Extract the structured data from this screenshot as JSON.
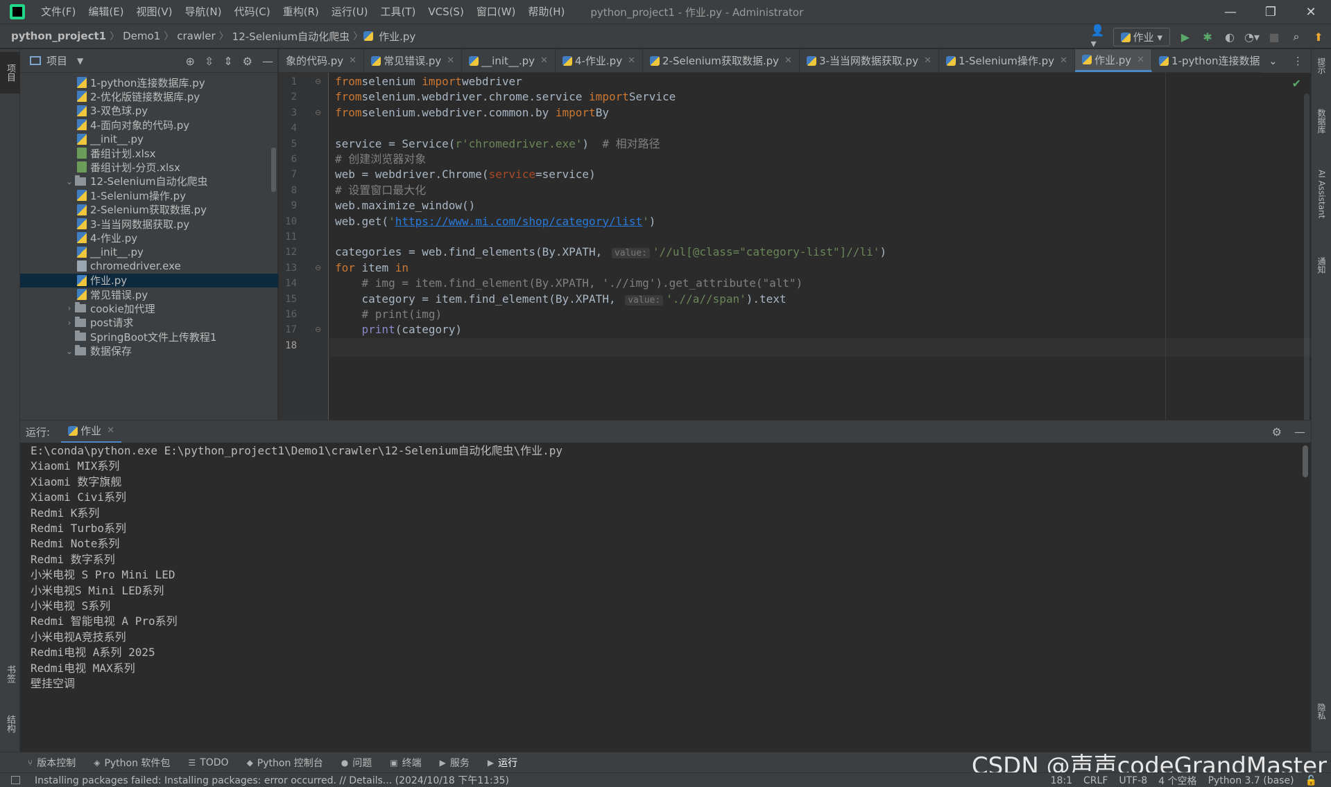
{
  "menu": [
    "文件(F)",
    "编辑(E)",
    "视图(V)",
    "导航(N)",
    "代码(C)",
    "重构(R)",
    "运行(U)",
    "工具(T)",
    "VCS(S)",
    "窗口(W)",
    "帮助(H)"
  ],
  "window_title": "python_project1 - 作业.py - Administrator",
  "breadcrumbs": [
    "python_project1",
    "Demo1",
    "crawler",
    "12-Selenium自动化爬虫",
    "作业.py"
  ],
  "run_config": "作业",
  "left_stripe": {
    "project": "项目",
    "bookmarks": "书签",
    "structure": "结构"
  },
  "right_stripe": {
    "notifications_top": "提示",
    "database": "数据库",
    "ai_assistant": "AI Assistant",
    "notifications": "通知",
    "protect": "隐私"
  },
  "project_panel": {
    "title": "项目",
    "tree": [
      {
        "label": "1-python连接数据库.py",
        "type": "py",
        "indent": 4
      },
      {
        "label": "2-优化版链接数据库.py",
        "type": "py",
        "indent": 4
      },
      {
        "label": "3-双色球.py",
        "type": "py",
        "indent": 4
      },
      {
        "label": "4-面向对象的代码.py",
        "type": "py",
        "indent": 4
      },
      {
        "label": "__init__.py",
        "type": "py",
        "indent": 4
      },
      {
        "label": "番组计划.xlsx",
        "type": "xlsx",
        "indent": 4
      },
      {
        "label": "番组计划-分页.xlsx",
        "type": "xlsx",
        "indent": 4
      },
      {
        "label": "12-Selenium自动化爬虫",
        "type": "folder-open",
        "indent": 3
      },
      {
        "label": "1-Selenium操作.py",
        "type": "py",
        "indent": 4
      },
      {
        "label": "2-Selenium获取数据.py",
        "type": "py",
        "indent": 4
      },
      {
        "label": "3-当当网数据获取.py",
        "type": "py",
        "indent": 4
      },
      {
        "label": "4-作业.py",
        "type": "py",
        "indent": 4
      },
      {
        "label": "__init__.py",
        "type": "py",
        "indent": 4
      },
      {
        "label": "chromedriver.exe",
        "type": "exe",
        "indent": 4
      },
      {
        "label": "作业.py",
        "type": "py",
        "indent": 4,
        "selected": true
      },
      {
        "label": "常见错误.py",
        "type": "py",
        "indent": 4
      },
      {
        "label": "cookie加代理",
        "type": "folder-closed",
        "indent": 3
      },
      {
        "label": "post请求",
        "type": "folder-closed",
        "indent": 3
      },
      {
        "label": "SpringBoot文件上传教程1",
        "type": "folder",
        "indent": 3
      },
      {
        "label": "数据保存",
        "type": "folder-open",
        "indent": 3
      }
    ]
  },
  "editor_tabs": [
    {
      "label": "象的代码.py",
      "active": false
    },
    {
      "label": "常见错误.py",
      "active": false
    },
    {
      "label": "__init__.py",
      "active": false
    },
    {
      "label": "4-作业.py",
      "active": false
    },
    {
      "label": "2-Selenium获取数据.py",
      "active": false
    },
    {
      "label": "3-当当网数据获取.py",
      "active": false
    },
    {
      "label": "1-Selenium操作.py",
      "active": false
    },
    {
      "label": "作业.py",
      "active": true
    },
    {
      "label": "1-python连接数据",
      "active": false
    }
  ],
  "code": [
    [
      [
        "kw",
        "from"
      ],
      [
        "",
        "selenium "
      ],
      [
        "kw",
        "import"
      ],
      [
        "",
        "webdriver"
      ]
    ],
    [
      [
        "kw",
        "from"
      ],
      [
        "",
        "selenium.webdriver.chrome.service "
      ],
      [
        "kw",
        "import"
      ],
      [
        "",
        "Service"
      ]
    ],
    [
      [
        "kw",
        "from"
      ],
      [
        "",
        "selenium.webdriver.common.by "
      ],
      [
        "kw",
        "import"
      ],
      [
        "",
        "By"
      ]
    ],
    [],
    [
      [
        "",
        "service = Service("
      ],
      [
        "str",
        "r'chromedriver.exe'"
      ],
      [
        "",
        ")  "
      ],
      [
        "cm",
        "# 相对路径"
      ]
    ],
    [
      [
        "cm",
        "# 创建浏览器对象"
      ]
    ],
    [
      [
        "",
        "web = webdriver.Chrome("
      ],
      [
        "param",
        "service"
      ],
      [
        "",
        "=service)"
      ]
    ],
    [
      [
        "cm",
        "# 设置窗口最大化"
      ]
    ],
    [
      [
        "",
        "web.maximize_window()"
      ]
    ],
    [
      [
        "",
        "web.get("
      ],
      [
        "str",
        "'"
      ],
      [
        "url",
        "https://www.mi.com/shop/category/list"
      ],
      [
        "str",
        "'"
      ],
      [
        "",
        ")"
      ]
    ],
    [],
    [
      [
        "",
        "categories = web.find_elements(By.XPATH, "
      ],
      [
        "hint",
        "value:"
      ],
      [
        "str",
        "'//ul[@class=\"category-list\"]//li'"
      ],
      [
        "",
        ")"
      ]
    ],
    [
      [
        "kw",
        "for"
      ],
      [
        "",
        " item "
      ],
      [
        "kw",
        "in"
      ],
      [
        "",
        "",
        " categories:"
      ]
    ],
    [
      [
        "",
        "    "
      ],
      [
        "cm",
        "# img = item.find_element(By.XPATH, './/img').get_attribute(\"alt\")"
      ]
    ],
    [
      [
        "",
        "    category = item.find_element(By.XPATH, "
      ],
      [
        "hint",
        "value:"
      ],
      [
        "str",
        "'.//a//span'"
      ],
      [
        "",
        ").text"
      ]
    ],
    [
      [
        "",
        "    "
      ],
      [
        "cm",
        "# print(img)"
      ]
    ],
    [
      [
        "",
        "    "
      ],
      [
        "bi",
        "print"
      ],
      [
        "",
        "(category)"
      ]
    ],
    []
  ],
  "current_line": 18,
  "run_panel": {
    "label": "运行:",
    "tab": "作业",
    "output": [
      "E:\\conda\\python.exe E:\\python_project1\\Demo1\\crawler\\12-Selenium自动化爬虫\\作业.py",
      "Xiaomi MIX系列",
      "Xiaomi 数字旗舰",
      "Xiaomi Civi系列",
      "Redmi K系列",
      "Redmi Turbo系列",
      "Redmi Note系列",
      "Redmi 数字系列",
      "小米电视 S Pro Mini LED",
      "小米电视S Mini LED系列",
      "小米电视 S系列",
      "Redmi 智能电视 A Pro系列",
      "小米电视A竞技系列",
      "Redmi电视 A系列 2025",
      "Redmi电视 MAX系列",
      "壁挂空调"
    ]
  },
  "bottom_tools": [
    {
      "icon": "branch-icon",
      "glyph": "⑂",
      "label": "版本控制"
    },
    {
      "icon": "package-icon",
      "glyph": "◈",
      "label": "Python 软件包"
    },
    {
      "icon": "todo-icon",
      "glyph": "☰",
      "label": "TODO"
    },
    {
      "icon": "python-console-icon",
      "glyph": "◆",
      "label": "Python 控制台"
    },
    {
      "icon": "problems-icon",
      "glyph": "●",
      "label": "问题"
    },
    {
      "icon": "terminal-icon",
      "glyph": "▣",
      "label": "终端"
    },
    {
      "icon": "services-icon",
      "glyph": "▶",
      "label": "服务"
    },
    {
      "icon": "run-icon",
      "glyph": "▶",
      "label": "运行"
    }
  ],
  "watermark": "CSDN @声声codeGrandMaster",
  "status": {
    "message": "Installing packages failed: Installing packages: error occurred. // Details... (2024/10/18 下午11:35)",
    "position": "18:1",
    "line_sep": "CRLF",
    "encoding": "UTF-8",
    "indent": "4 个空格",
    "interpreter": "Python 3.7 (base)"
  },
  "colors": {
    "keyword": "#cc7832",
    "string": "#6a8759",
    "comment": "#808080",
    "accent": "#4a88c7",
    "run_green": "#59a869"
  }
}
